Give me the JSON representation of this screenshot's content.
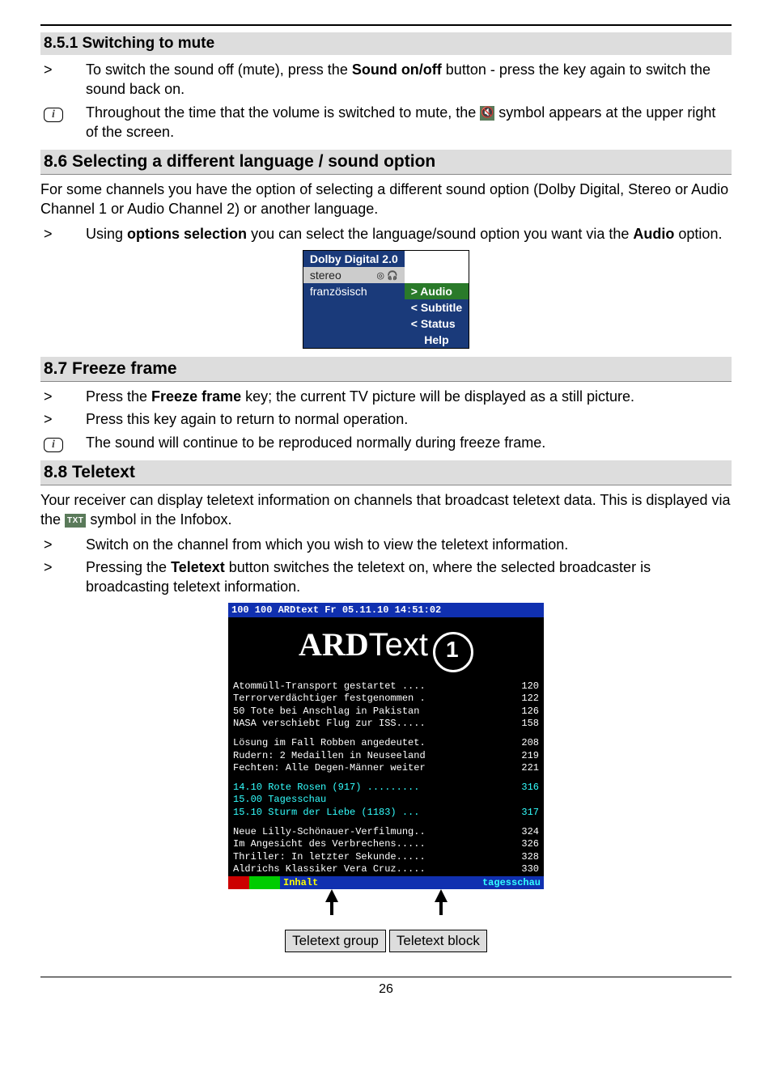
{
  "s851": {
    "h": "8.5.1 Switching to mute",
    "r1a": "To switch the sound off (mute), press the ",
    "r1b": "Sound on/off",
    "r1c": " button - press the key again to switch the sound back on.",
    "r2a": "Throughout the time that the volume is switched to mute, the ",
    "r2b": " symbol appears at the upper right of the screen."
  },
  "s86": {
    "h": "8.6 Selecting a different language / sound option",
    "p": "For some channels you have the option of selecting a different sound option (Dolby Digital, Stereo or Audio Channel 1 or Audio Channel 2) or another language.",
    "r1a": "Using ",
    "r1b": "options selection",
    "r1c": " you can select the language/sound option you want via the ",
    "r1d": "Audio",
    "r1e": " option."
  },
  "dolby": {
    "hdr": "Dolby Digital 2.0",
    "stereo": "stereo",
    "franz": "französisch",
    "icons": "◎ 🎧",
    "audio": "> Audio",
    "sub": "< Subtitle",
    "stat": "< Status",
    "help": "Help"
  },
  "s87": {
    "h": "8.7 Freeze frame",
    "r1a": "Press the ",
    "r1b": "Freeze frame",
    "r1c": " key; the current TV picture will be displayed as a still picture.",
    "r2": "Press this key again to return to normal operation.",
    "r3": "The sound will continue to be reproduced normally during freeze frame."
  },
  "s88": {
    "h": "8.8 Teletext",
    "p1a": "Your receiver can display teletext information on channels that broadcast teletext data. This is displayed via the ",
    "p1b": " symbol in the Infobox.",
    "txtIcon": "TXT",
    "r1": "Switch on the channel from which you wish to view the teletext information.",
    "r2a": "Pressing the ",
    "r2b": "Teletext",
    "r2c": " button switches the teletext on, where the selected broadcaster is broadcasting teletext information."
  },
  "ard": {
    "top": "100    100 ARDtext Fr 05.11.10 14:51:02",
    "logo": "ARD",
    "logoT": "Text",
    "l": [
      {
        "t": "Atommüll-Transport gestartet ....",
        "n": "120"
      },
      {
        "t": "Terrorverdächtiger festgenommen .",
        "n": "122"
      },
      {
        "t": "50 Tote bei Anschlag in Pakistan",
        "n": "126"
      },
      {
        "t": "NASA verschiebt Flug zur ISS.....",
        "n": "158"
      },
      {
        "t": "Lösung im Fall Robben angedeutet.",
        "n": "208"
      },
      {
        "t": "Rudern: 2 Medaillen in Neuseeland",
        "n": "219"
      },
      {
        "t": "Fechten: Alle Degen-Männer weiter",
        "n": "221"
      },
      {
        "t": "14.10  Rote Rosen (917) .........",
        "n": "316",
        "c": 1
      },
      {
        "t": "15.00  Tagesschau",
        "n": "",
        "c": 1
      },
      {
        "t": "15.10  Sturm der Liebe (1183) ...",
        "n": "317",
        "c": 1
      },
      {
        "t": "Neue Lilly-Schönauer-Verfilmung..",
        "n": "324"
      },
      {
        "t": "Im Angesicht des Verbrechens.....",
        "n": "326"
      },
      {
        "t": "Thriller: In letzter Sekunde.....",
        "n": "328"
      },
      {
        "t": "Aldrichs Klassiker Vera Cruz.....",
        "n": "330"
      }
    ],
    "by": "Inhalt",
    "bb": "tagesschau"
  },
  "lbl": {
    "g": "Teletext group",
    "b": "Teletext block"
  },
  "gt": ">",
  "info": "i",
  "page": "26"
}
